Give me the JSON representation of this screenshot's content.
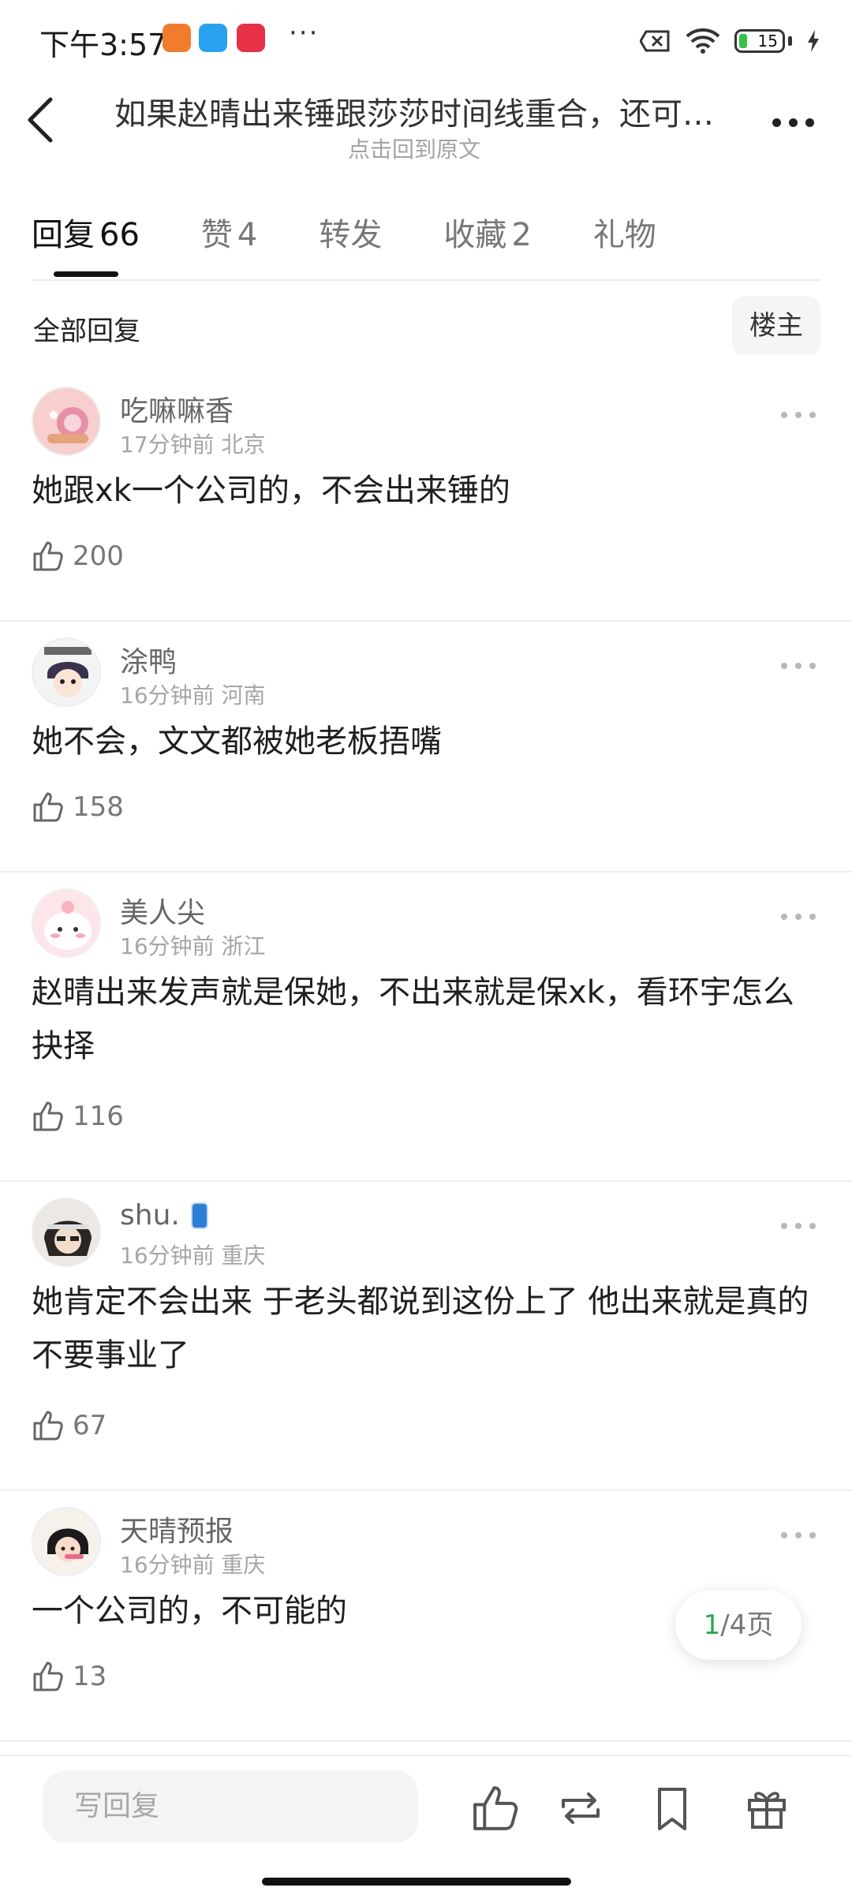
{
  "status_bar": {
    "time": "下午3:57",
    "battery": "15"
  },
  "header": {
    "title": "如果赵晴出来锤跟莎莎时间线重合，还可…",
    "subtitle": "点击回到原文"
  },
  "tabs": [
    {
      "label": "回复",
      "count": "66"
    },
    {
      "label": "赞",
      "count": "4"
    },
    {
      "label": "转发",
      "count": ""
    },
    {
      "label": "收藏",
      "count": "2"
    },
    {
      "label": "礼物",
      "count": ""
    }
  ],
  "filter": {
    "all_label": "全部回复",
    "op_label": "楼主"
  },
  "comments": [
    {
      "username": "吃嘛嘛香",
      "time": "17分钟前",
      "location": "北京",
      "text": "她跟xk一个公司的，不会出来锤的",
      "likes": "200"
    },
    {
      "username": "涂鸭",
      "time": "16分钟前",
      "location": "河南",
      "text": "她不会，文文都被她老板捂嘴",
      "likes": "158"
    },
    {
      "username": "美人尖",
      "time": "16分钟前",
      "location": "浙江",
      "text": "赵晴出来发声就是保她，不出来就是保xk，看环宇怎么抉择",
      "likes": "116"
    },
    {
      "username": "shu.",
      "time": "16分钟前",
      "location": "重庆",
      "text": "她肯定不会出来 于老头都说到这份上了 他出来就是真的不要事业了",
      "likes": "67"
    },
    {
      "username": "天晴预报",
      "time": "16分钟前",
      "location": "重庆",
      "text": "一个公司的，不可能的",
      "likes": "13"
    }
  ],
  "pagination": {
    "current": "1",
    "total": "/4页"
  },
  "bottom_bar": {
    "reply_placeholder": "写回复"
  },
  "colors": {
    "accent_green": "#2da94f",
    "text_primary": "#1f1f1f",
    "text_secondary": "#a6a6a6"
  },
  "icons": [
    "back-arrow-icon",
    "more-icon",
    "thumbs-up-icon",
    "repost-icon",
    "bookmark-icon",
    "gift-icon",
    "wifi-icon",
    "battery-icon"
  ]
}
